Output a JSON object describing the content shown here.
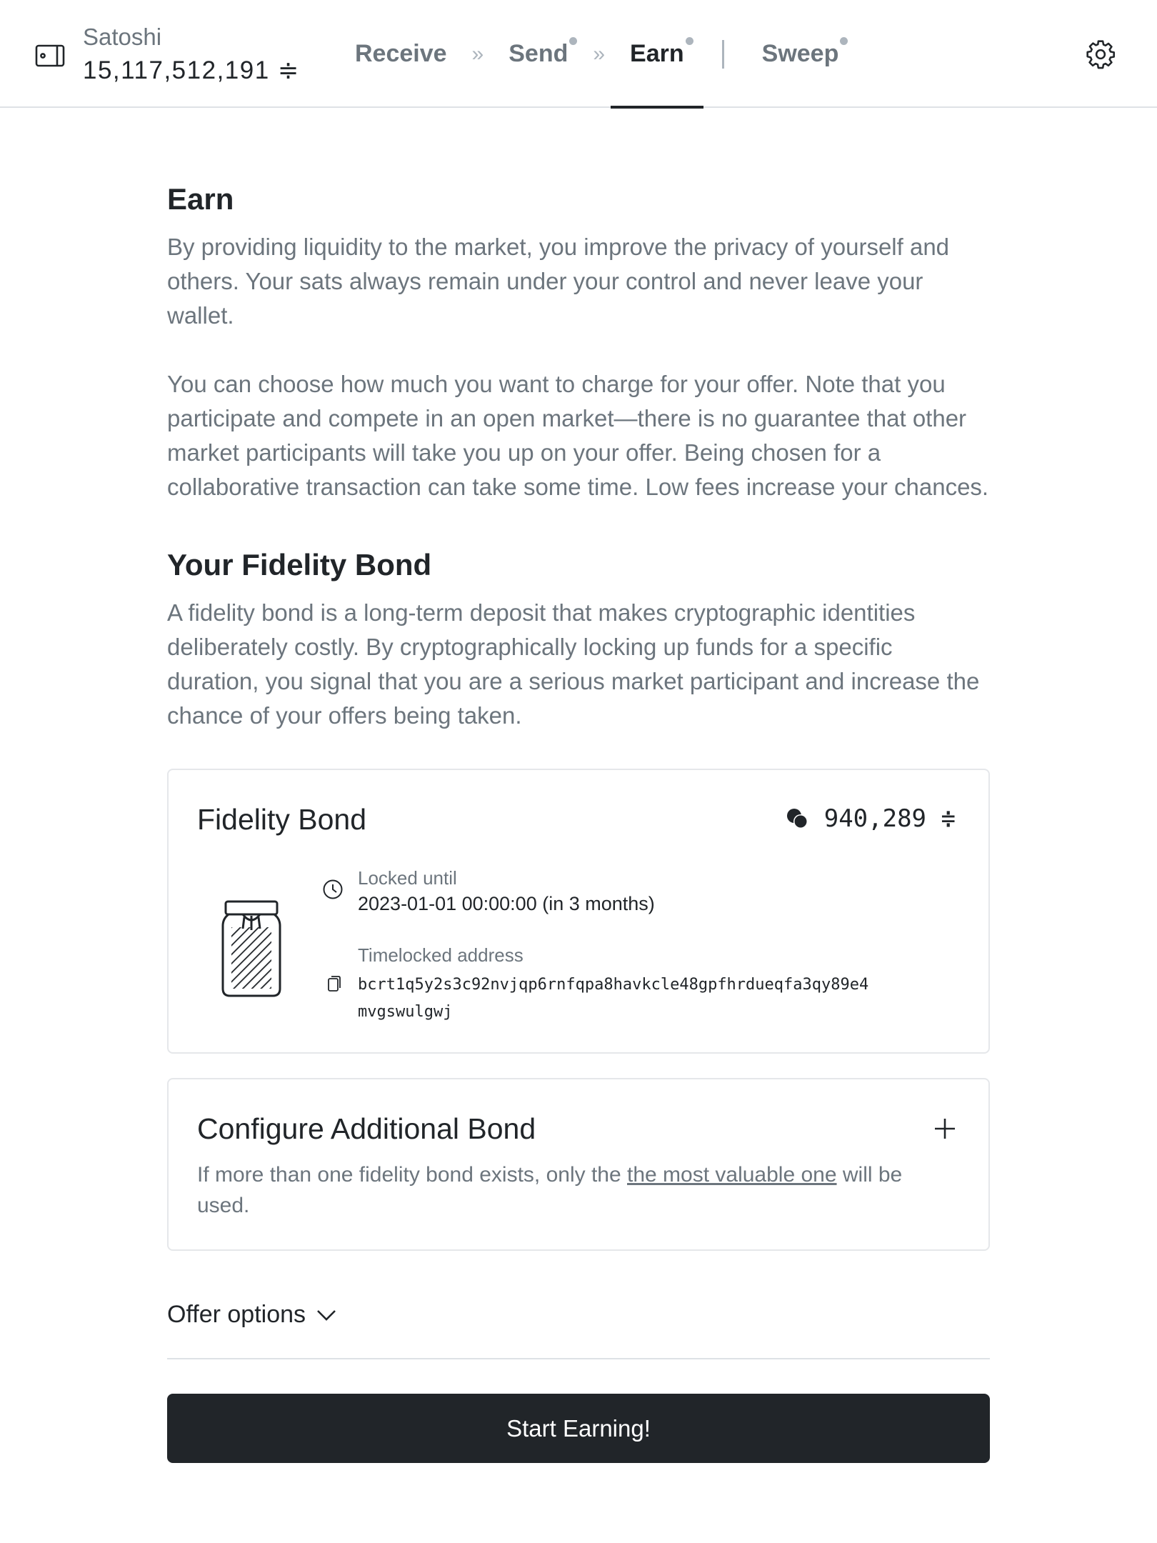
{
  "wallet": {
    "name": "Satoshi",
    "balance": "15,117,512,191",
    "unit_symbol": "≑"
  },
  "nav": {
    "receive": "Receive",
    "send": "Send",
    "earn": "Earn",
    "sweep": "Sweep",
    "separator": "»",
    "active": "Earn"
  },
  "earn": {
    "title": "Earn",
    "paragraph1": "By providing liquidity to the market, you improve the privacy of yourself and others. Your sats always remain under your control and never leave your wallet.",
    "paragraph2": "You can choose how much you want to charge for your offer. Note that you participate and compete in an open market—there is no guarantee that other market participants will take you up on your offer. Being chosen for a collaborative transaction can take some time. Low fees increase your chances."
  },
  "fidelity": {
    "title": "Your Fidelity Bond",
    "description": "A fidelity bond is a long-term deposit that makes cryptographic identities deliberately costly. By cryptographically locking up funds for a specific duration, you signal that you are a serious market participant and increase the chance of your offers being taken."
  },
  "bond_card": {
    "title": "Fidelity Bond",
    "amount": "940,289",
    "unit_symbol": "≑",
    "locked_label": "Locked until",
    "locked_value": "2023-01-01 00:00:00 (in 3 months)",
    "address_label": "Timelocked address",
    "address": "bcrt1q5y2s3c92nvjqp6rnfqpa8havkcle48gpfhrdueqfa3qy89e4mvgswulgwj"
  },
  "config_card": {
    "title": "Configure Additional Bond",
    "desc_before": "If more than one fidelity bond exists, only the ",
    "desc_link": "the most valuable one",
    "desc_after": " will be used."
  },
  "offer_options": {
    "label": "Offer options"
  },
  "start_button": {
    "label": "Start Earning!"
  },
  "icons": {
    "wallet": "wallet-icon",
    "settings": "gear-icon",
    "coins": "coins-icon",
    "jar": "jar-icon",
    "clock": "clock-icon",
    "copy": "copy-icon",
    "plus": "plus-icon",
    "chevron": "chevron-down-icon"
  },
  "colors": {
    "primary": "#212529",
    "muted": "#6c757d",
    "border": "#dee2e6",
    "nav_dot": "#adb5bd"
  }
}
